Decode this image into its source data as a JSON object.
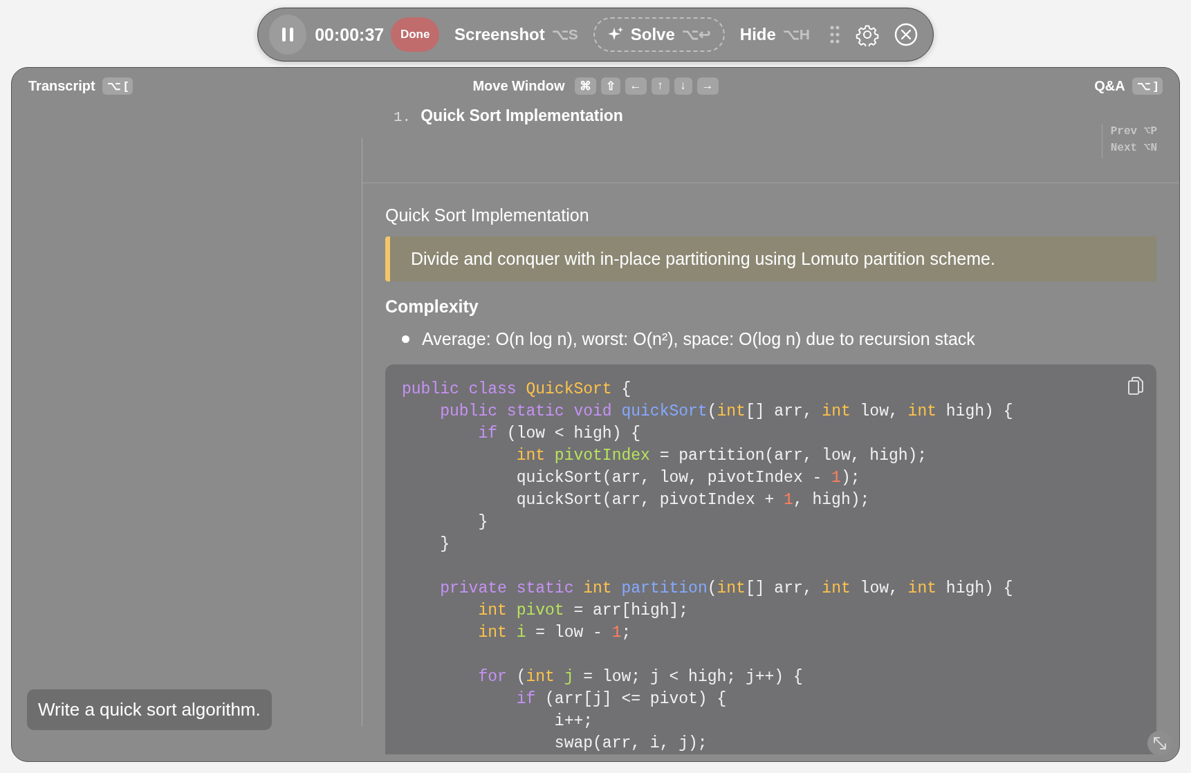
{
  "toolbar": {
    "timer": "00:00:37",
    "done_label": "Done",
    "buttons": [
      {
        "label": "Screenshot",
        "shortcut": "⌥S",
        "kind": "plain"
      },
      {
        "label": "Solve",
        "shortcut": "⌥↩",
        "kind": "dashed"
      },
      {
        "label": "Hide",
        "shortcut": "⌥H",
        "kind": "plain"
      }
    ]
  },
  "header": {
    "left": {
      "label": "Transcript",
      "shortcut": "⌥ ["
    },
    "center": {
      "label": "Move Window",
      "keys": [
        "⌘",
        "⇧",
        "←",
        "↑",
        "↓",
        "→"
      ]
    },
    "right": {
      "label": "Q&A",
      "shortcut": "⌥ ]"
    }
  },
  "transcript": {
    "messages": [
      "Write a quick sort algorithm."
    ]
  },
  "qa": {
    "questions": [
      {
        "number": "1.",
        "title": "Quick Sort Implementation"
      }
    ],
    "nav": [
      {
        "label": "Prev",
        "shortcut": "⌥P"
      },
      {
        "label": "Next",
        "shortcut": "⌥N"
      }
    ],
    "answer": {
      "title": "Quick Sort Implementation",
      "callout": "Divide and conquer with in-place partitioning using Lomuto partition scheme.",
      "sections": [
        {
          "heading": "Complexity",
          "bullets": [
            "Average: O(n log n), worst: O(n²), space: O(log n) due to recursion stack"
          ]
        }
      ],
      "code": {
        "lines": [
          {
            "kind": "code",
            "tokens": [
              {
                "kind": "keyword",
                "text": "public class "
              },
              {
                "kind": "type",
                "text": "QuickSort"
              },
              {
                "kind": "plain",
                "text": " {"
              }
            ]
          },
          {
            "kind": "code",
            "tokens": [
              {
                "kind": "keyword",
                "text": "    public static void "
              },
              {
                "kind": "function",
                "text": "quickSort"
              },
              {
                "kind": "plain",
                "text": "("
              },
              {
                "kind": "type",
                "text": "int"
              },
              {
                "kind": "plain",
                "text": "[] arr, "
              },
              {
                "kind": "type",
                "text": "int"
              },
              {
                "kind": "plain",
                "text": " low, "
              },
              {
                "kind": "type",
                "text": "int"
              },
              {
                "kind": "plain",
                "text": " high) {"
              }
            ]
          },
          {
            "kind": "code",
            "tokens": [
              {
                "kind": "keyword",
                "text": "        if"
              },
              {
                "kind": "plain",
                "text": " (low < high) {"
              }
            ]
          },
          {
            "kind": "code",
            "tokens": [
              {
                "kind": "type",
                "text": "            int"
              },
              {
                "kind": "variable",
                "text": " pivotIndex"
              },
              {
                "kind": "plain",
                "text": " = partition(arr, low, high);"
              }
            ]
          },
          {
            "kind": "code",
            "tokens": [
              {
                "kind": "plain",
                "text": "            quickSort(arr, low, pivotIndex - "
              },
              {
                "kind": "number",
                "text": "1"
              },
              {
                "kind": "plain",
                "text": ");"
              }
            ]
          },
          {
            "kind": "code",
            "tokens": [
              {
                "kind": "plain",
                "text": "            quickSort(arr, pivotIndex + "
              },
              {
                "kind": "number",
                "text": "1"
              },
              {
                "kind": "plain",
                "text": ", high);"
              }
            ]
          },
          {
            "kind": "code",
            "tokens": [
              {
                "kind": "plain",
                "text": "        }"
              }
            ]
          },
          {
            "kind": "code",
            "tokens": [
              {
                "kind": "plain",
                "text": "    }"
              }
            ]
          },
          {
            "kind": "blank"
          },
          {
            "kind": "code",
            "tokens": [
              {
                "kind": "keyword",
                "text": "    private static "
              },
              {
                "kind": "type",
                "text": "int"
              },
              {
                "kind": "function",
                "text": " partition"
              },
              {
                "kind": "plain",
                "text": "("
              },
              {
                "kind": "type",
                "text": "int"
              },
              {
                "kind": "plain",
                "text": "[] arr, "
              },
              {
                "kind": "type",
                "text": "int"
              },
              {
                "kind": "plain",
                "text": " low, "
              },
              {
                "kind": "type",
                "text": "int"
              },
              {
                "kind": "plain",
                "text": " high) {"
              }
            ]
          },
          {
            "kind": "code",
            "tokens": [
              {
                "kind": "type",
                "text": "        int"
              },
              {
                "kind": "variable",
                "text": " pivot"
              },
              {
                "kind": "plain",
                "text": " = arr[high];"
              }
            ]
          },
          {
            "kind": "code",
            "tokens": [
              {
                "kind": "type",
                "text": "        int"
              },
              {
                "kind": "variable",
                "text": " i"
              },
              {
                "kind": "plain",
                "text": " = low - "
              },
              {
                "kind": "number",
                "text": "1"
              },
              {
                "kind": "plain",
                "text": ";"
              }
            ]
          },
          {
            "kind": "blank"
          },
          {
            "kind": "code",
            "tokens": [
              {
                "kind": "keyword",
                "text": "        for"
              },
              {
                "kind": "plain",
                "text": " ("
              },
              {
                "kind": "type",
                "text": "int"
              },
              {
                "kind": "variable",
                "text": " j"
              },
              {
                "kind": "plain",
                "text": " = low; j < high; j++) {"
              }
            ]
          },
          {
            "kind": "code",
            "tokens": [
              {
                "kind": "keyword",
                "text": "            if"
              },
              {
                "kind": "plain",
                "text": " (arr[j] <= pivot) {"
              }
            ]
          },
          {
            "kind": "code",
            "tokens": [
              {
                "kind": "plain",
                "text": "                i++;"
              }
            ]
          },
          {
            "kind": "code",
            "tokens": [
              {
                "kind": "plain",
                "text": "                swap(arr, i, j);"
              }
            ]
          }
        ]
      }
    }
  }
}
